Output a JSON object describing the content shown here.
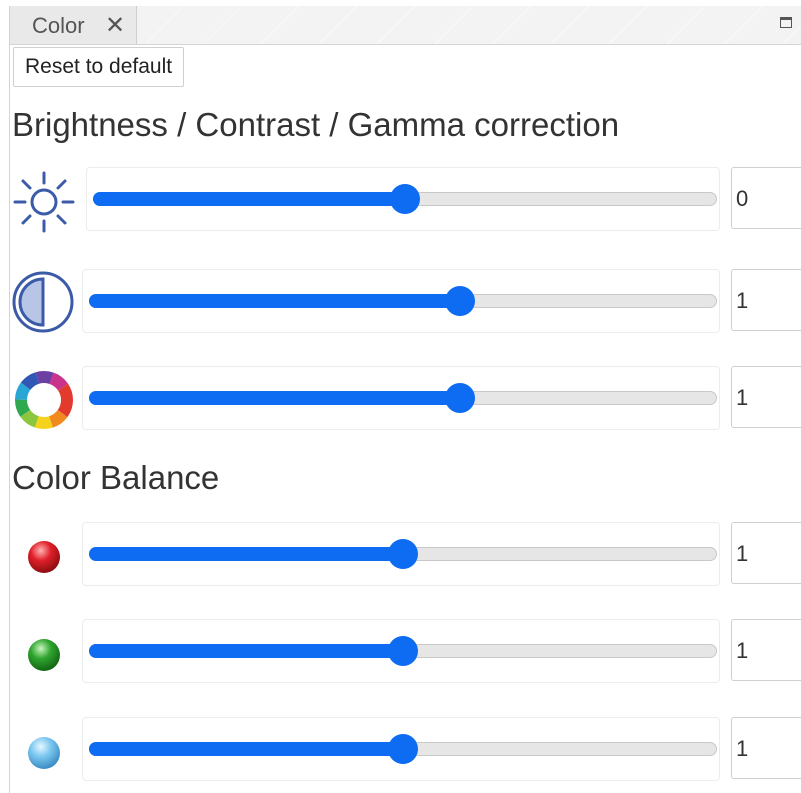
{
  "tab": {
    "label": "Color",
    "close_label": "✕"
  },
  "toolbar": {
    "reset_label": "Reset to default"
  },
  "sections": {
    "bcg_title": "Brightness / Contrast / Gamma correction",
    "balance_title": "Color Balance"
  },
  "sliders": [
    {
      "name": "brightness",
      "icon": "brightness-sun-icon",
      "value": "0",
      "fraction": 0.5
    },
    {
      "name": "contrast",
      "icon": "contrast-icon",
      "value": "1",
      "fraction": 0.59
    },
    {
      "name": "gamma",
      "icon": "color-wheel-icon",
      "value": "1",
      "fraction": 0.59
    },
    {
      "name": "red",
      "icon": "red-ball-icon",
      "value": "1",
      "fraction": 0.5
    },
    {
      "name": "green",
      "icon": "green-ball-icon",
      "value": "1",
      "fraction": 0.5
    },
    {
      "name": "blue",
      "icon": "blue-ball-icon",
      "value": "1",
      "fraction": 0.5
    }
  ],
  "colors": {
    "accent": "#0d6cf2",
    "icon_blue": "#3b5ba8",
    "red": "#e0202a",
    "green": "#2fa52f",
    "blue": "#7cc8f0"
  }
}
